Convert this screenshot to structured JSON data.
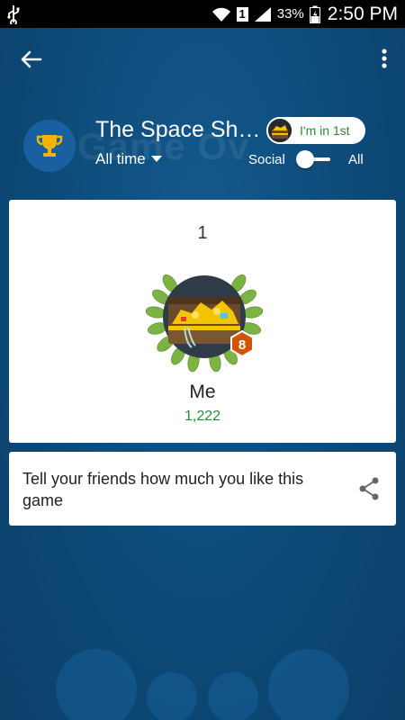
{
  "status_bar": {
    "usb_icon": "usb-icon",
    "sim_slot": "1",
    "battery_percent": "33%",
    "time": "2:50 PM"
  },
  "top_bar": {
    "back_icon": "arrow-left-icon",
    "menu_icon": "more-vert-icon"
  },
  "header": {
    "game_title": "The Space Sh…",
    "time_filter": "All time",
    "rank_chip_label": "I'm in 1st",
    "toggle_left_label": "Social",
    "toggle_right_label": "All",
    "toggle_on": false
  },
  "leaderboard_card": {
    "rank": "1",
    "player_name": "Me",
    "score": "1,222",
    "level_badge": "8"
  },
  "share_card": {
    "text": "Tell your friends how much you like this game"
  },
  "colors": {
    "background": "#0e4d7e",
    "accent_green": "#2c8a3a",
    "badge_orange": "#d35400"
  }
}
